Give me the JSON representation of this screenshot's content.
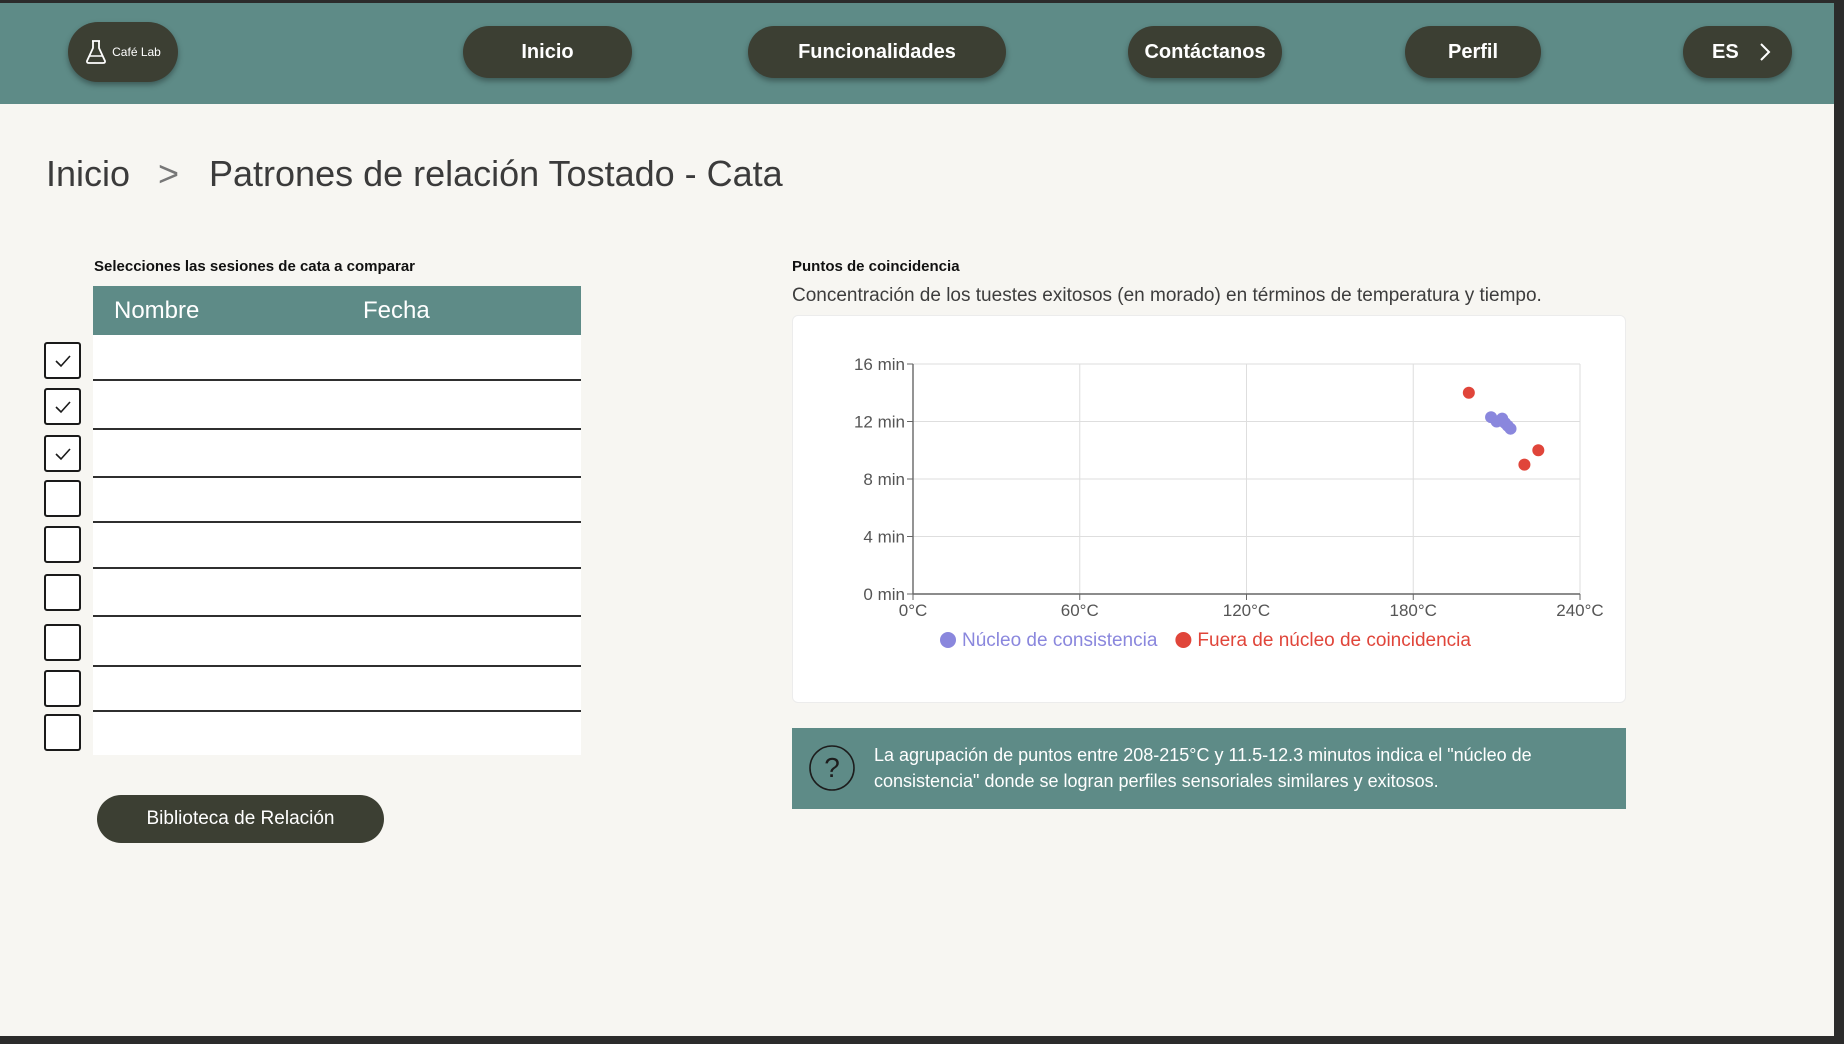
{
  "header": {
    "logo_text": "Café Lab",
    "nav": [
      {
        "label": "Inicio"
      },
      {
        "label": "Funcionalidades"
      },
      {
        "label": "Contáctanos"
      },
      {
        "label": "Perfil"
      }
    ],
    "language": "ES"
  },
  "breadcrumb": {
    "home": "Inicio",
    "separator": ">",
    "current": "Patrones de relación Tostado - Cata"
  },
  "sessions": {
    "label": "Selecciones las sesiones de cata a comparar",
    "columns": [
      "Nombre",
      "Fecha"
    ],
    "rows": [
      {
        "checked": true
      },
      {
        "checked": true
      },
      {
        "checked": true
      },
      {
        "checked": false
      },
      {
        "checked": false
      },
      {
        "checked": false
      },
      {
        "checked": false
      },
      {
        "checked": false
      },
      {
        "checked": false
      }
    ],
    "library_button": "Biblioteca de Relación"
  },
  "chart_panel": {
    "label": "Puntos de coincidencia",
    "description": "Concentración de los tuestes exitosos (en morado) en términos de temperatura y tiempo.",
    "info_text": "La agrupación de puntos entre 208-215°C y 11.5-12.3 minutos indica el \"núcleo de consistencia\" donde se logran perfiles sensoriales similares y exitosos."
  },
  "chart_data": {
    "type": "scatter",
    "title": "",
    "xlabel": "",
    "ylabel": "",
    "xlim": [
      0,
      240
    ],
    "ylim": [
      0,
      16
    ],
    "x_ticks": [
      "0°C",
      "60°C",
      "120°C",
      "180°C",
      "240°C"
    ],
    "x_tick_values": [
      0,
      60,
      120,
      180,
      240
    ],
    "y_ticks": [
      "0 min",
      "4 min",
      "8 min",
      "12 min",
      "16 min"
    ],
    "y_tick_values": [
      0,
      4,
      8,
      12,
      16
    ],
    "grid": true,
    "legend_position": "bottom",
    "series": [
      {
        "name": "Núcleo de consistencia",
        "color": "#8a87dd",
        "points": [
          [
            208,
            12.3
          ],
          [
            210,
            12.0
          ],
          [
            212,
            12.2
          ],
          [
            213,
            11.9
          ],
          [
            214,
            11.7
          ],
          [
            215,
            11.5
          ]
        ]
      },
      {
        "name": "Fuera de núcleo de coincidencia",
        "color": "#e0453a",
        "points": [
          [
            200,
            14.0
          ],
          [
            220,
            9.0
          ],
          [
            225,
            10.0
          ]
        ]
      }
    ]
  },
  "colors": {
    "header_bg": "#5e8b87",
    "pill_bg": "#3c3f33",
    "page_bg": "#f7f6f2"
  }
}
